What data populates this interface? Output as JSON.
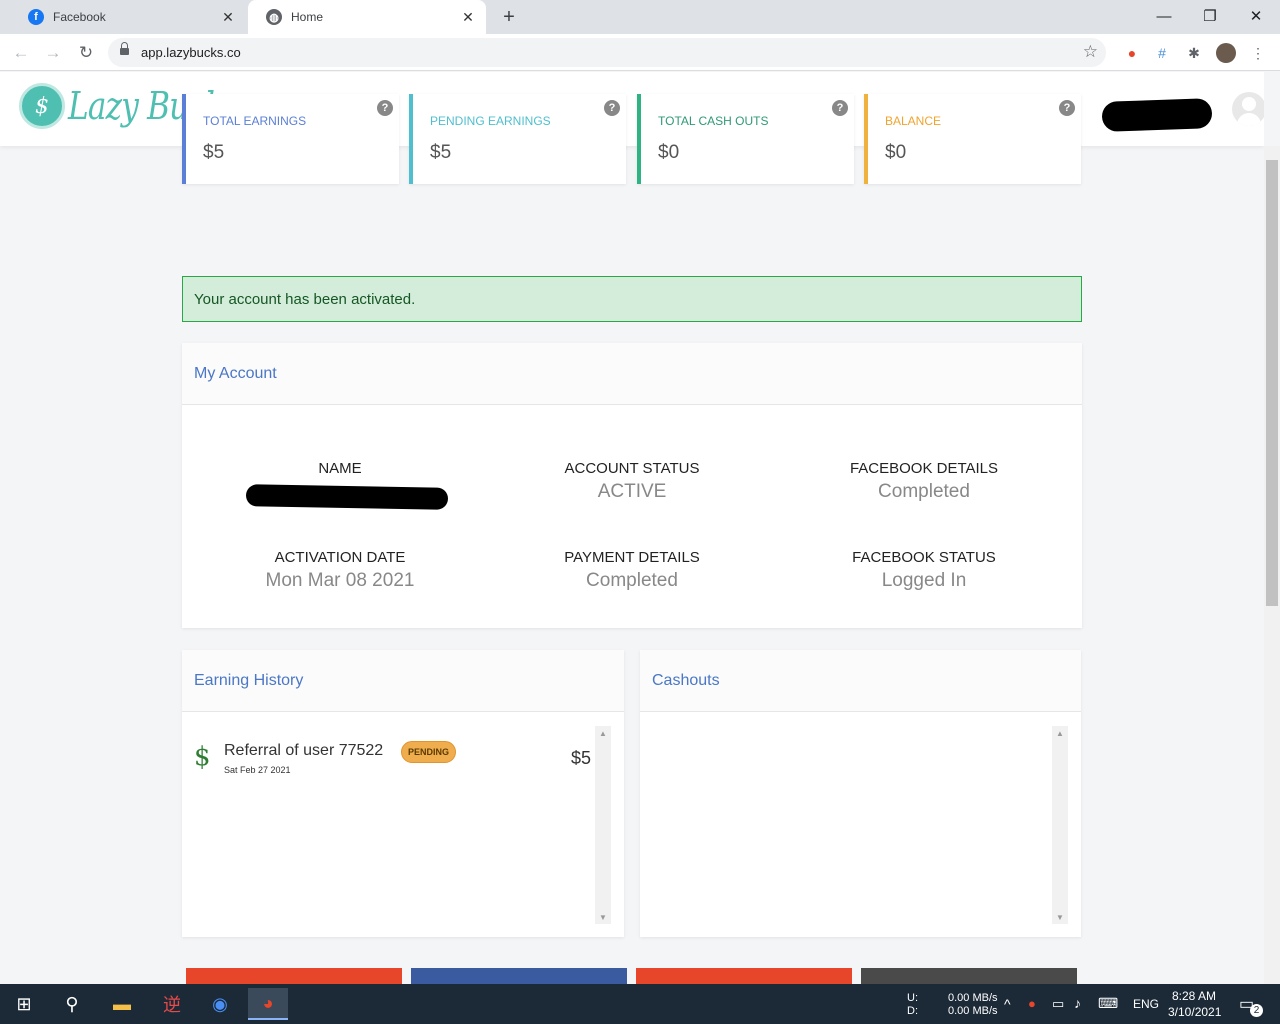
{
  "browser": {
    "tabs": [
      {
        "title": "Facebook",
        "active": false
      },
      {
        "title": "Home",
        "active": true
      }
    ],
    "url": "app.lazybucks.co"
  },
  "site": {
    "logo_text": "Lazy Bucks"
  },
  "stats": [
    {
      "label": "TOTAL EARNINGS",
      "value": "$5",
      "color": "#5b7fd6"
    },
    {
      "label": "PENDING EARNINGS",
      "value": "$5",
      "color": "#4fbfcf"
    },
    {
      "label": "TOTAL CASH OUTS",
      "value": "$0",
      "color": "#2fb384"
    },
    {
      "label": "BALANCE",
      "value": "$0",
      "color": "#f0b23e"
    }
  ],
  "alert": "Your account has been activated.",
  "my_account": {
    "title": "My Account",
    "items": [
      {
        "label": "NAME",
        "value": ""
      },
      {
        "label": "ACCOUNT STATUS",
        "value": "ACTIVE"
      },
      {
        "label": "FACEBOOK DETAILS",
        "value": "Completed"
      },
      {
        "label": "ACTIVATION DATE",
        "value": "Mon Mar 08 2021"
      },
      {
        "label": "PAYMENT DETAILS",
        "value": "Completed"
      },
      {
        "label": "FACEBOOK STATUS",
        "value": "Logged In"
      }
    ]
  },
  "earning_history": {
    "title": "Earning History",
    "rows": [
      {
        "title": "Referral of user 77522",
        "date": "Sat Feb 27 2021",
        "status": "PENDING",
        "amount": "$5"
      }
    ]
  },
  "cashouts": {
    "title": "Cashouts"
  },
  "bottom_buttons": [
    {
      "color": "#e8462a"
    },
    {
      "color": "#3b5ba0"
    },
    {
      "color": "#e8462a"
    },
    {
      "color": "#4a4a4a"
    }
  ],
  "taskbar": {
    "net_up_label": "U:",
    "net_down_label": "D:",
    "net_up": "0.00 MB/s",
    "net_down": "0.00 MB/s",
    "lang": "ENG",
    "time": "8:28 AM",
    "date": "3/10/2021",
    "notifications": "2"
  }
}
